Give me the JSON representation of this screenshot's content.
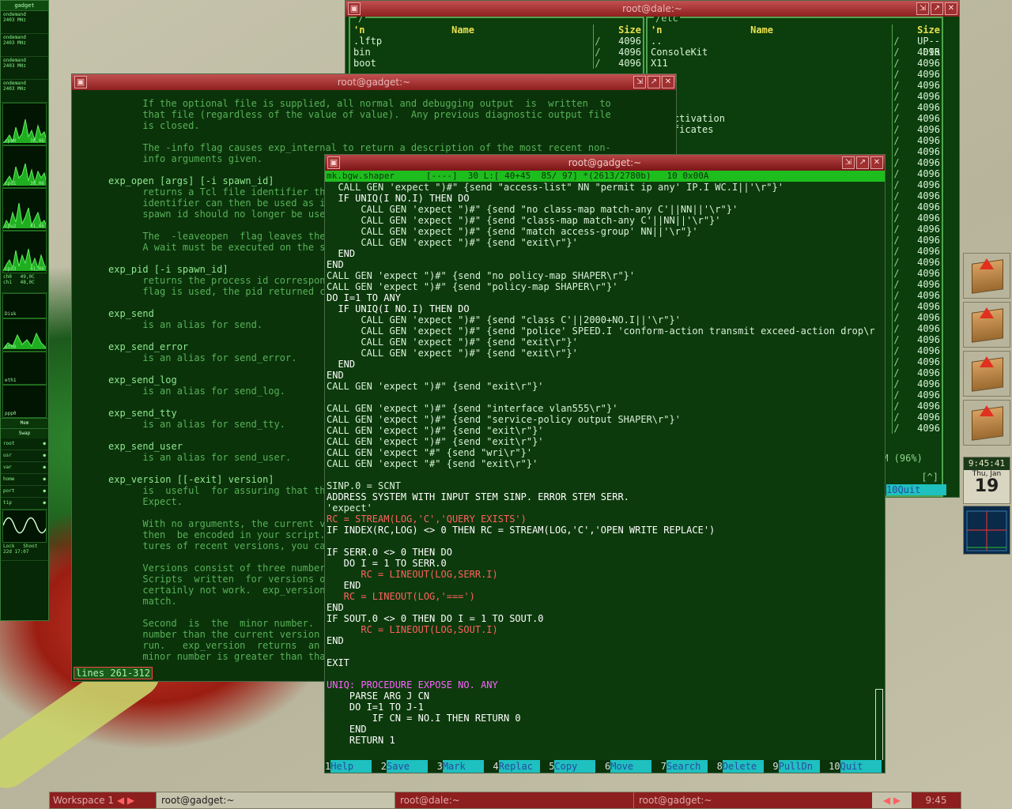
{
  "gkrellm": {
    "title": "gadget",
    "cpu_freq": [
      "ondemand\n2403 MHz",
      "ondemand\n2403 MHz",
      "ondemand\n2403 MHz",
      "ondemand\n2403 MHz"
    ],
    "cpus": [
      {
        "name": "cpu0",
        "value": "38,06"
      },
      {
        "name": "cpu1",
        "value": "38,06"
      },
      {
        "name": "cpu2",
        "value": "41,06"
      },
      {
        "name": "cpu3",
        "value": "41,06"
      }
    ],
    "sensors": "ch0   49,0C\nch1   48,0C",
    "disk_label": "Disk",
    "net": [
      "eth0",
      "eth1",
      "ppp0"
    ],
    "mem_label": "Mem",
    "swap_label": "Swap",
    "fs": [
      {
        "name": "root",
        "state": "●"
      },
      {
        "name": "usr",
        "state": "●"
      },
      {
        "name": "var",
        "state": "●"
      },
      {
        "name": "home",
        "state": "●"
      },
      {
        "name": "port",
        "state": "●"
      },
      {
        "name": "tip",
        "state": "●"
      }
    ],
    "bottom": "Lock   Shoot\n22d 17:07"
  },
  "mc_window": {
    "title": "root@dale:~",
    "left_path": "/",
    "right_path": "/etc",
    "col_n": "'n",
    "col_name": "Name",
    "col_size": "Size",
    "left_rows": [
      {
        "name": ".lftp",
        "sep": "/",
        "size": "4096"
      },
      {
        "name": "bin",
        "sep": "/",
        "size": "4096"
      },
      {
        "name": "boot",
        "sep": "/",
        "size": "4096"
      }
    ],
    "right_rows": [
      {
        "name": "..",
        "sep": "/",
        "size": "UP--DIR"
      },
      {
        "name": "ConsoleKit",
        "sep": "/",
        "size": "4096"
      },
      {
        "name": "X11",
        "sep": "/",
        "size": "4096"
      },
      {
        "name": "",
        "sep": "/",
        "size": "4096"
      },
      {
        "name": "",
        "sep": "/",
        "size": "4096"
      },
      {
        "name": "",
        "sep": "/",
        "size": "4096"
      },
      {
        "name": "",
        "sep": "/",
        "size": "4096"
      },
      {
        "name": "bo-activation",
        "sep": "/",
        "size": "4096"
      },
      {
        "name": "ertificates",
        "sep": "/",
        "size": "4096"
      },
      {
        "name": "d",
        "sep": "/",
        "size": "4096"
      },
      {
        "name": "",
        "sep": "/",
        "size": "4096"
      },
      {
        "name": "",
        "sep": "/",
        "size": "4096"
      },
      {
        "name": "",
        "sep": "/",
        "size": "4096"
      },
      {
        "name": "",
        "sep": "/",
        "size": "4096"
      },
      {
        "name": "",
        "sep": "/",
        "size": "4096"
      },
      {
        "name": "",
        "sep": "/",
        "size": "4096"
      },
      {
        "name": "",
        "sep": "/",
        "size": "4096"
      },
      {
        "name": "",
        "sep": "/",
        "size": "4096"
      },
      {
        "name": "",
        "sep": "/",
        "size": "4096"
      },
      {
        "name": "",
        "sep": "/",
        "size": "4096"
      },
      {
        "name": "",
        "sep": "/",
        "size": "4096"
      },
      {
        "name": "",
        "sep": "/",
        "size": "4096"
      },
      {
        "name": "",
        "sep": "/",
        "size": "4096"
      },
      {
        "name": "",
        "sep": "/",
        "size": "4096"
      },
      {
        "name": "",
        "sep": "/",
        "size": "4096"
      },
      {
        "name": "",
        "sep": "/",
        "size": "4096"
      },
      {
        "name": "",
        "sep": "/",
        "size": "4096"
      },
      {
        "name": "",
        "sep": "/",
        "size": "4096"
      },
      {
        "name": "",
        "sep": "/",
        "size": "4096"
      },
      {
        "name": "",
        "sep": "/",
        "size": "4096"
      },
      {
        "name": "",
        "sep": "/",
        "size": "4096"
      },
      {
        "name": "",
        "sep": "/",
        "size": "4096"
      },
      {
        "name": "",
        "sep": "/",
        "size": "4096"
      },
      {
        "name": "",
        "sep": "/",
        "size": "4096"
      },
      {
        "name": "",
        "sep": "/",
        "size": "4096"
      },
      {
        "name": "",
        "sep": "/",
        "size": "4096"
      }
    ],
    "disk_free": "4M (96%)",
    "quit_label": "10Quit",
    "bracket": "[^]"
  },
  "man_window": {
    "title": "root@gadget:~",
    "lines": [
      "      If the optional file is supplied, all normal and debugging output  is  written  to",
      "      that file (regardless of the value of value).  Any previous diagnostic output file",
      "      is closed.",
      "",
      "      The -info flag causes exp_internal to return a description of the most recent non-",
      "      info arguments given.",
      "",
      "exp_open [args] [-i spawn_id]",
      "      returns a Tcl file identifier tha",
      "      identifier can then be used as if",
      "      spawn id should no longer be used",
      "",
      "      The  -leaveopen  flag leaves the ",
      "      A wait must be executed on the sp",
      "",
      "exp_pid [-i spawn_id]",
      "      returns the process id correspon",
      "      flag is used, the pid returned co",
      "",
      "exp_send",
      "      is an alias for send.",
      "",
      "exp_send_error",
      "      is an alias for send_error.",
      "",
      "exp_send_log",
      "      is an alias for send_log.",
      "",
      "exp_send_tty",
      "      is an alias for send_tty.",
      "",
      "exp_send_user",
      "      is an alias for send_user.",
      "",
      "exp_version [[-exit] version]",
      "      is  useful  for assuring that the",
      "      Expect.",
      "",
      "      With no arguments, the current ve",
      "      then  be encoded in your script. ",
      "      tures of recent versions, you ca",
      "",
      "      Versions consist of three numbers",
      "      Scripts  written  for versions o",
      "      certainly not work.  exp_version",
      "      match.",
      "",
      "      Second  is  the  minor number.  S",
      "      number than the current version ",
      "      run.   exp_version  returns  an ",
      "      minor number is greater than tha"
    ],
    "status": "lines 261-312"
  },
  "editor_window": {
    "title": "root@gadget:~",
    "status_line": "mk.bgw.shaper      [----]  30 L:[ 40+45  85/ 97] *(2613/2780b)   10 0x00A",
    "lines": [
      "  CALL GEN 'expect \")#\" {send \"access-list\" NN \"permit ip any' IP.I WC.I||'\\r\"}'",
      "  IF UNIQ(I NO.I) THEN DO",
      "      CALL GEN 'expect \")#\" {send \"no class-map match-any C'||NN||'\\r\"}'",
      "      CALL GEN 'expect \")#\" {send \"class-map match-any C'||NN||'\\r\"}'",
      "      CALL GEN 'expect \")#\" {send \"match access-group' NN||'\\r\"}'",
      "      CALL GEN 'expect \")#\" {send \"exit\\r\"}'",
      "  END",
      "END",
      "CALL GEN 'expect \")#\" {send \"no policy-map SHAPER\\r\"}'",
      "CALL GEN 'expect \")#\" {send \"policy-map SHAPER\\r\"}'",
      "DO I=1 TO ANY",
      "  IF UNIQ(I NO.I) THEN DO",
      "      CALL GEN 'expect \")#\" {send \"class C'||2000+NO.I||'\\r\"}'",
      "      CALL GEN 'expect \")#\" {send \"police' SPEED.I 'conform-action transmit exceed-action drop\\r",
      "      CALL GEN 'expect \")#\" {send \"exit\\r\"}'",
      "      CALL GEN 'expect \")#\" {send \"exit\\r\"}'",
      "  END",
      "END",
      "CALL GEN 'expect \")#\" {send \"exit\\r\"}'",
      "",
      "CALL GEN 'expect \")#\" {send \"interface vlan555\\r\"}'",
      "CALL GEN 'expect \")#\" {send \"service-policy output SHAPER\\r\"}'",
      "CALL GEN 'expect \")#\" {send \"exit\\r\"}'",
      "CALL GEN 'expect \")#\" {send \"exit\\r\"}'",
      "CALL GEN 'expect \"#\" {send \"wri\\r\"}'",
      "CALL GEN 'expect \"#\" {send \"exit\\r\"}'",
      "",
      "SINP.0 = SCNT",
      "ADDRESS SYSTEM WITH INPUT STEM SINP. ERROR STEM SERR.",
      "'expect'",
      "RC = STREAM(LOG,'C','QUERY EXISTS')",
      "IF INDEX(RC,LOG) <> 0 THEN RC = STREAM(LOG,'C','OPEN WRITE REPLACE')",
      "",
      "IF SERR.0 <> 0 THEN DO",
      "   DO I = 1 TO SERR.0",
      "      RC = LINEOUT(LOG,SERR.I)",
      "   END",
      "   RC = LINEOUT(LOG,'===')",
      "END",
      "IF SOUT.0 <> 0 THEN DO I = 1 TO SOUT.0",
      "      RC = LINEOUT(LOG,SOUT.I)",
      "END",
      "",
      "EXIT",
      "",
      "UNIQ: PROCEDURE EXPOSE NO. ANY",
      "    PARSE ARG J CN",
      "    DO I=1 TO J-1",
      "        IF CN = NO.I THEN RETURN 0",
      "    END",
      "    RETURN 1"
    ],
    "fkeys": [
      {
        "num": "1",
        "label": "Help"
      },
      {
        "num": "2",
        "label": "Save"
      },
      {
        "num": "3",
        "label": "Mark"
      },
      {
        "num": "4",
        "label": "Replac"
      },
      {
        "num": "5",
        "label": "Copy"
      },
      {
        "num": "6",
        "label": "Move"
      },
      {
        "num": "7",
        "label": "Search"
      },
      {
        "num": "8",
        "label": "Delete"
      },
      {
        "num": "9",
        "label": "PullDn"
      },
      {
        "num": "10",
        "label": "Quit"
      }
    ]
  },
  "clock": {
    "time": "9:45:41",
    "day": "Thu, Jan",
    "date": "19"
  },
  "taskbar": {
    "workspace": "Workspace 1",
    "tasks": [
      "root@gadget:~",
      "root@dale:~",
      "root@gadget:~"
    ],
    "time": "9:45"
  },
  "colors": {
    "titlebar": "#8e1f1f",
    "terminal_bg": "#0a330a",
    "accent": "#1ec0c0"
  }
}
